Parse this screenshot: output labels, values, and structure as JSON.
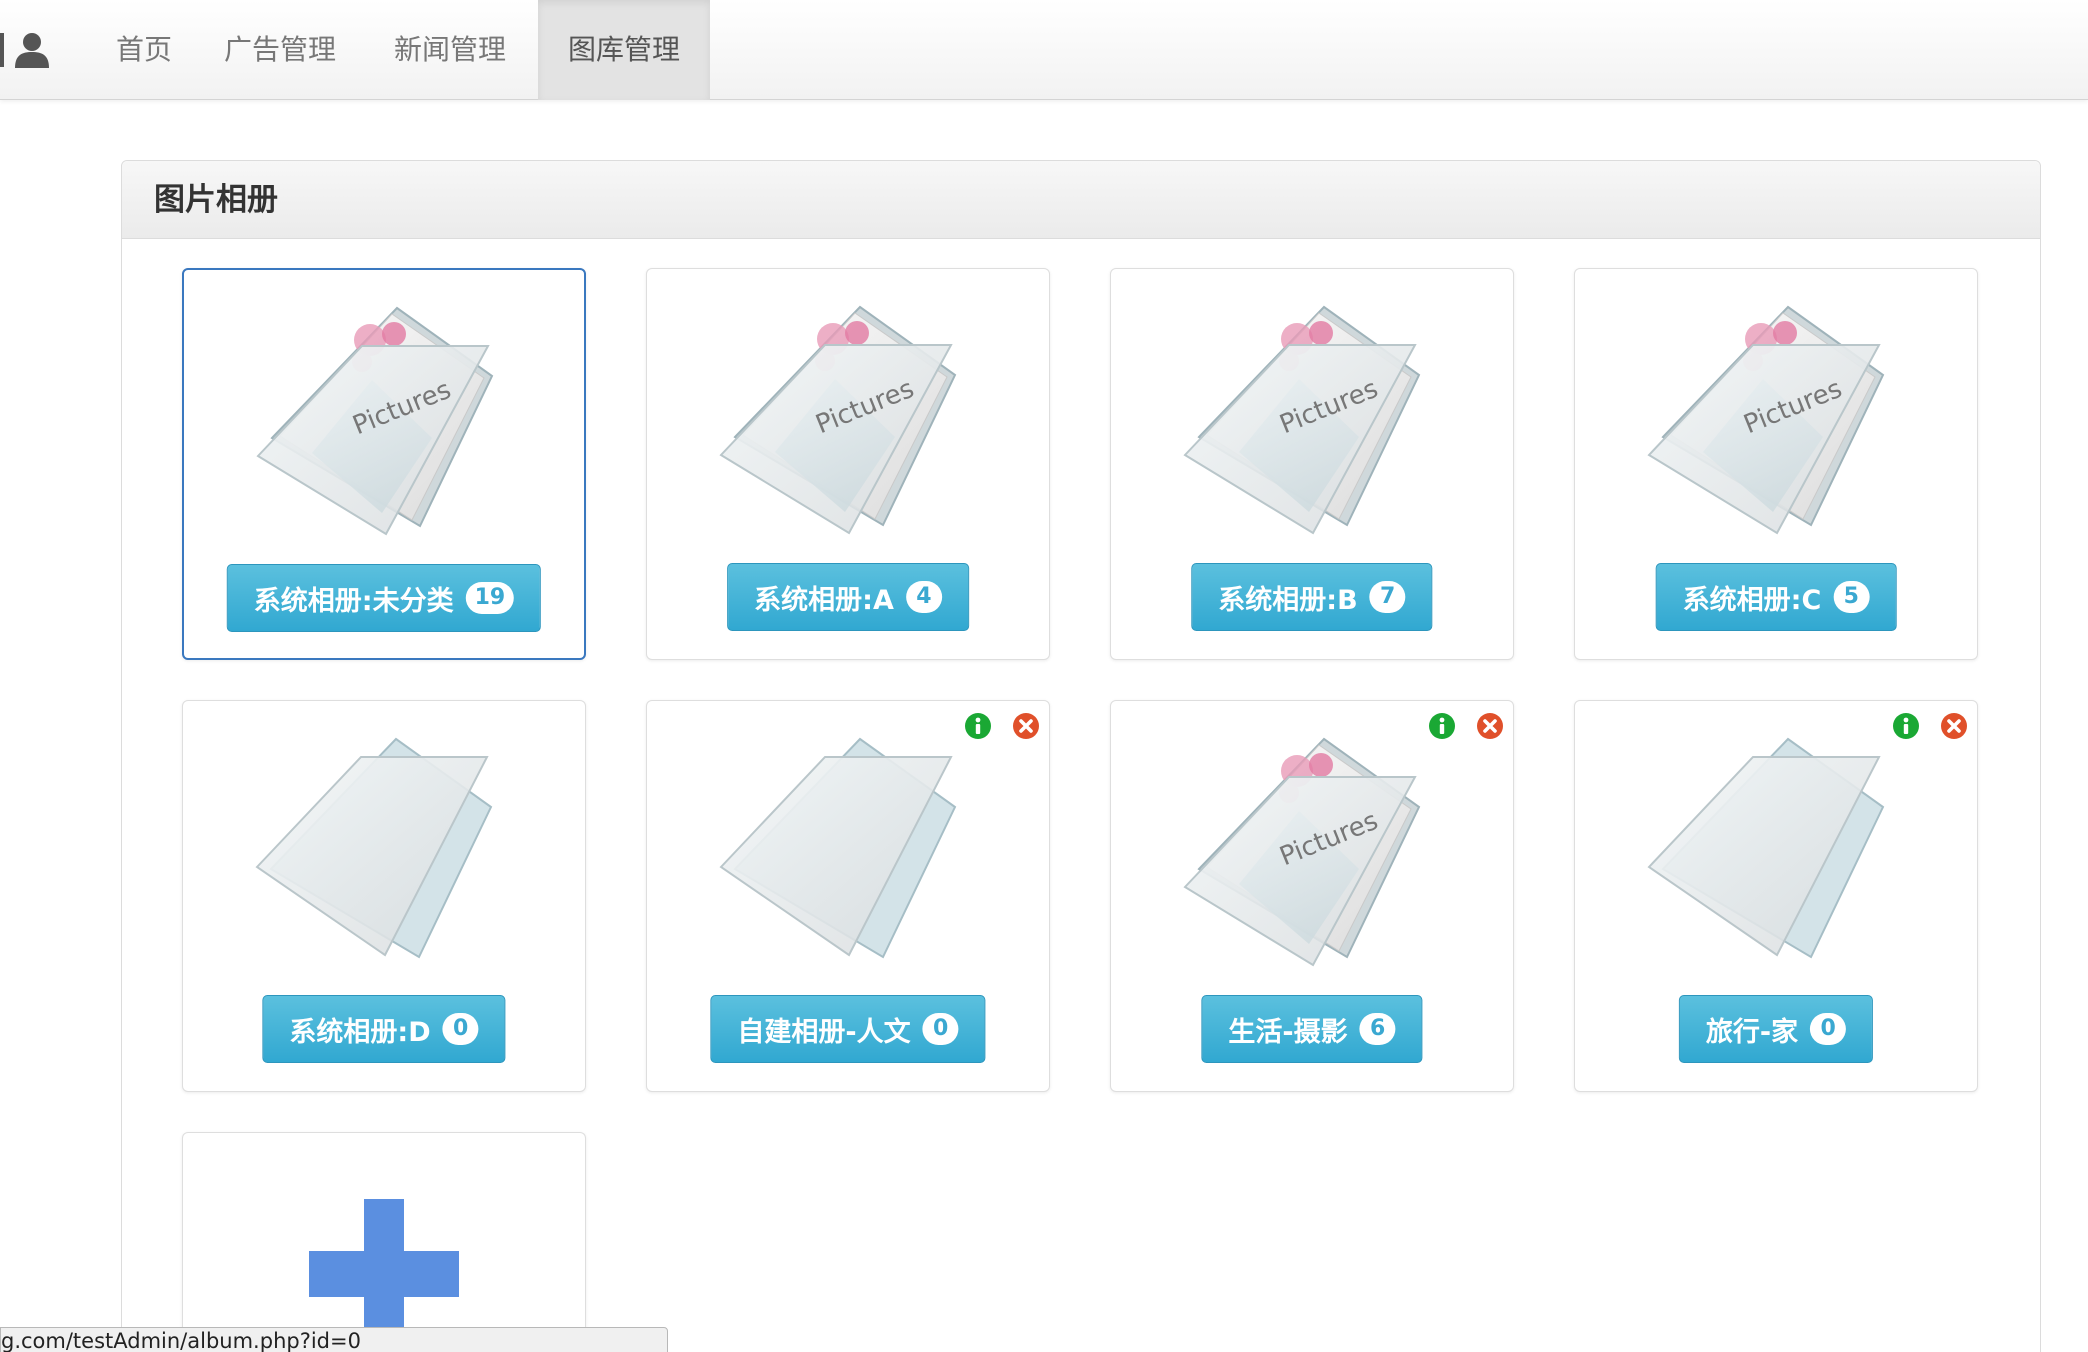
{
  "nav": {
    "items": [
      {
        "label": "首页"
      },
      {
        "label": "广告管理"
      },
      {
        "label": "新闻管理"
      },
      {
        "label": "图库管理",
        "active": true
      }
    ]
  },
  "panel": {
    "title": "图片相册"
  },
  "albums": [
    {
      "name": "系统相册:未分类",
      "count": "19",
      "has_photos": true,
      "selected": true,
      "editable": false
    },
    {
      "name": "系统相册:A",
      "count": "4",
      "has_photos": true,
      "editable": false
    },
    {
      "name": "系统相册:B",
      "count": "7",
      "has_photos": true,
      "editable": false
    },
    {
      "name": "系统相册:C",
      "count": "5",
      "has_photos": true,
      "editable": false
    },
    {
      "name": "系统相册:D",
      "count": "0",
      "has_photos": false,
      "editable": false
    },
    {
      "name": "自建相册-人文",
      "count": "0",
      "has_photos": false,
      "editable": true
    },
    {
      "name": "生活-摄影",
      "count": "6",
      "has_photos": true,
      "editable": true
    },
    {
      "name": "旅行-家",
      "count": "0",
      "has_photos": false,
      "editable": true
    }
  ],
  "icons": {
    "user": "user-icon",
    "folder_photos": "pictures-folder-icon",
    "folder_empty": "empty-folder-icon",
    "info": "info-icon",
    "remove": "remove-icon",
    "add": "plus-icon"
  },
  "folder_label": "Pictures",
  "colors": {
    "button": "#31a8d1",
    "info": "#1aa834",
    "remove": "#e0502a",
    "add": "#5b8fe0",
    "selected_border": "#3a78bf"
  },
  "status_url": "g.com/testAdmin/album.php?id=0"
}
